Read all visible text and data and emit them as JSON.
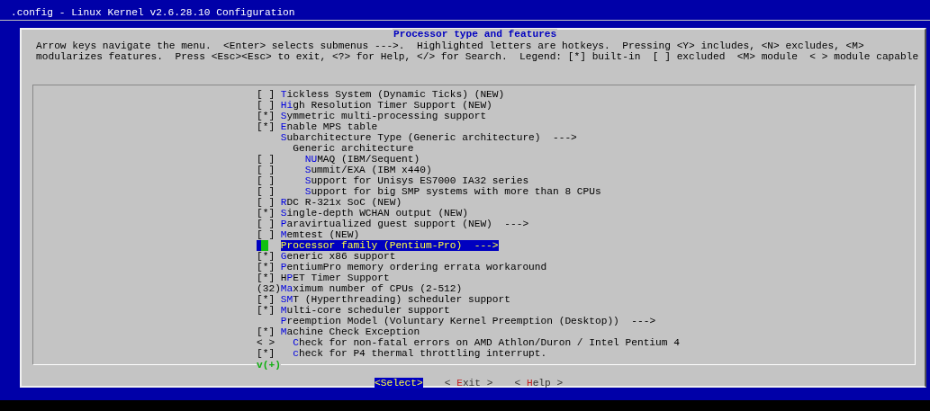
{
  "window": {
    "title": ".config - Linux Kernel v2.6.28.10 Configuration"
  },
  "dialog": {
    "title": "Processor type and features",
    "help_lines": [
      "Arrow keys navigate the menu.  <Enter> selects submenus --->.  Highlighted letters are hotkeys.  Pressing <Y> includes, <N> excludes, <M>",
      "modularizes features.  Press <Esc><Esc> to exit, <?> for Help, </> for Search.  Legend: [*] built-in  [ ] excluded  <M> module  < > module capable"
    ],
    "items": [
      {
        "prefix": "[ ]",
        "hotkey": "T",
        "text": "ickless System (Dynamic Ticks) (NEW)",
        "selected": false
      },
      {
        "prefix": "[ ]",
        "hotkey": "Hi",
        "text": "gh Resolution Timer Support (NEW)",
        "selected": false
      },
      {
        "prefix": "[*]",
        "hotkey": "S",
        "text": "ymmetric multi-processing support",
        "selected": false
      },
      {
        "prefix": "[*]",
        "hotkey": "E",
        "text": "nable MPS table",
        "selected": false
      },
      {
        "hotkey": "S",
        "text": "ubarchitecture Type (Generic architecture)  --->",
        "selected": false,
        "children": [
          {
            "text": "Generic architecture",
            "selected": false,
            "children": [
              {
                "prefix": "[ ]",
                "hotkey": "NU",
                "text": "MAQ (IBM/Sequent)",
                "selected": false
              },
              {
                "prefix": "[ ]",
                "hotkey": "S",
                "text": "ummit/EXA (IBM x440)",
                "selected": false
              },
              {
                "prefix": "[ ]",
                "hotkey": "S",
                "text": "upport for Unisys ES7000 IA32 series",
                "selected": false
              },
              {
                "prefix": "[ ]",
                "hotkey": "S",
                "text": "upport for big SMP systems with more than 8 CPUs",
                "selected": false
              }
            ]
          }
        ]
      },
      {
        "prefix": "[ ]",
        "hotkey": "R",
        "text": "DC R-321x SoC (NEW)",
        "selected": false
      },
      {
        "prefix": "[*]",
        "hotkey": "S",
        "text": "ingle-depth WCHAN output (NEW)",
        "selected": false
      },
      {
        "prefix": "[ ]",
        "hotkey": "P",
        "text": "aravirtualized guest support (NEW)  --->",
        "selected": false
      },
      {
        "prefix": "[ ]",
        "hotkey": "M",
        "text": "emtest (NEW)",
        "selected": false
      },
      {
        "hotkey": "P",
        "text": "rocessor family (Pentium-Pro)  --->",
        "selected": true
      },
      {
        "prefix": "[*]",
        "hotkey": "G",
        "text": "eneric x86 support",
        "selected": false
      },
      {
        "prefix": "[*]",
        "hotkey": "P",
        "text": "entiumPro memory ordering errata workaround",
        "selected": false
      },
      {
        "prefix": "[*]",
        "before": "H",
        "hotkey": "P",
        "text": "ET Timer Support",
        "selected": false
      },
      {
        "prefix": "(32)",
        "hotkey": "Ma",
        "text": "ximum number of CPUs (2-512)",
        "selected": false
      },
      {
        "prefix": "[*]",
        "hotkey": "SM",
        "text": "T (Hyperthreading) scheduler support",
        "selected": false
      },
      {
        "prefix": "[*]",
        "hotkey": "M",
        "text": "ulti-core scheduler support",
        "selected": false
      },
      {
        "hotkey": "P",
        "text": "reemption Model (Voluntary Kernel Preemption (Desktop))  --->",
        "selected": false
      },
      {
        "prefix": "[*]",
        "hotkey": "M",
        "text": "achine Check Exception",
        "selected": false,
        "children": [
          {
            "prefix": "< >",
            "hotkey": "C",
            "text": "heck for non-fatal errors on AMD Athlon/Duron / Intel Pentium 4",
            "selected": false
          },
          {
            "prefix": "[*]",
            "hotkey": "c",
            "text": "heck for P4 thermal throttling interrupt.",
            "selected": false
          }
        ]
      }
    ],
    "scroll_indicator": "v(+)",
    "buttons": [
      {
        "before": "<",
        "hotkey": "S",
        "text": "elect>",
        "selected": true
      },
      {
        "before": "< ",
        "hotkey": "E",
        "text": "xit >",
        "selected": false
      },
      {
        "before": "< ",
        "hotkey": "H",
        "text": "elp >",
        "selected": false
      }
    ]
  }
}
